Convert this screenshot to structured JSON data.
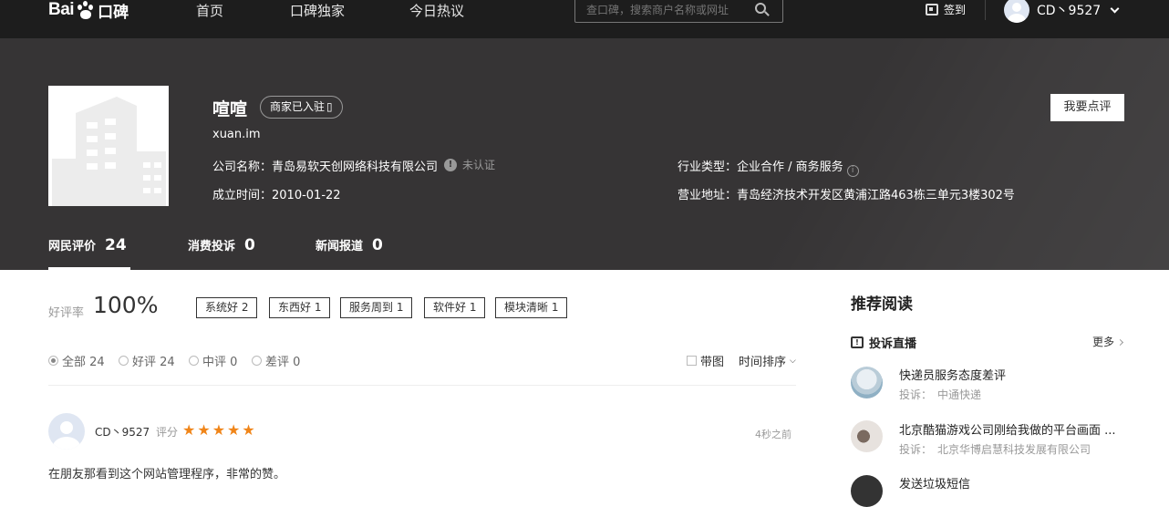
{
  "nav": {
    "logo_text": "Bai",
    "logo_suffix": "口碑",
    "links": [
      "首页",
      "口碑独家",
      "今日热议"
    ],
    "search_placeholder": "查口碑，搜索商户名称或网址",
    "signin_label": "签到",
    "username": "CD丶9527"
  },
  "merchant": {
    "name": "喧喧",
    "settled_badge": "商家已入驻",
    "domain": "xuan.im",
    "company_label": "公司名称：",
    "company_name": "青岛易软天创网络科技有限公司",
    "unverified": "未认证",
    "founded_label": "成立时间：",
    "founded": "2010-01-22",
    "industry_label": "行业类型：",
    "industry": "企业合作 / 商务服务",
    "address_label": "营业地址：",
    "address": "青岛经济技术开发区黄浦江路463栋三单元3楼302号",
    "write_review": "我要点评"
  },
  "tabs": [
    {
      "label": "网民评价",
      "count": "24"
    },
    {
      "label": "消费投诉",
      "count": "0"
    },
    {
      "label": "新闻报道",
      "count": "0"
    }
  ],
  "rating": {
    "label": "好评率",
    "value": "100%",
    "tags": [
      "系统好 2",
      "东西好 1",
      "服务周到 1",
      "软件好 1",
      "模块清晰 1"
    ]
  },
  "filters": {
    "all": "全部 24",
    "good": "好评 24",
    "medium": "中评 0",
    "bad": "差评 0",
    "with_image": "带图",
    "sort": "时间排序"
  },
  "review": {
    "user": "CD丶9527",
    "score_label": "评分",
    "stars": 5,
    "time": "4秒之前",
    "text": "在朋友那看到这个网站管理程序，非常的赞。"
  },
  "sidebar": {
    "title": "推荐阅读",
    "section": "投诉直播",
    "more": "更多",
    "items": [
      {
        "title": "快递员服务态度差评",
        "prefix": "投诉：",
        "target": "中通快递"
      },
      {
        "title": "北京酷猫游戏公司刚给我做的平台画面 ...",
        "prefix": "投诉：",
        "target": "北京华博启慧科技发展有限公司"
      },
      {
        "title": "发送垃圾短信",
        "prefix": "",
        "target": ""
      }
    ]
  },
  "colors": {
    "topnav": "#1d1d1d",
    "band": "#363435",
    "star": "#f08519"
  }
}
